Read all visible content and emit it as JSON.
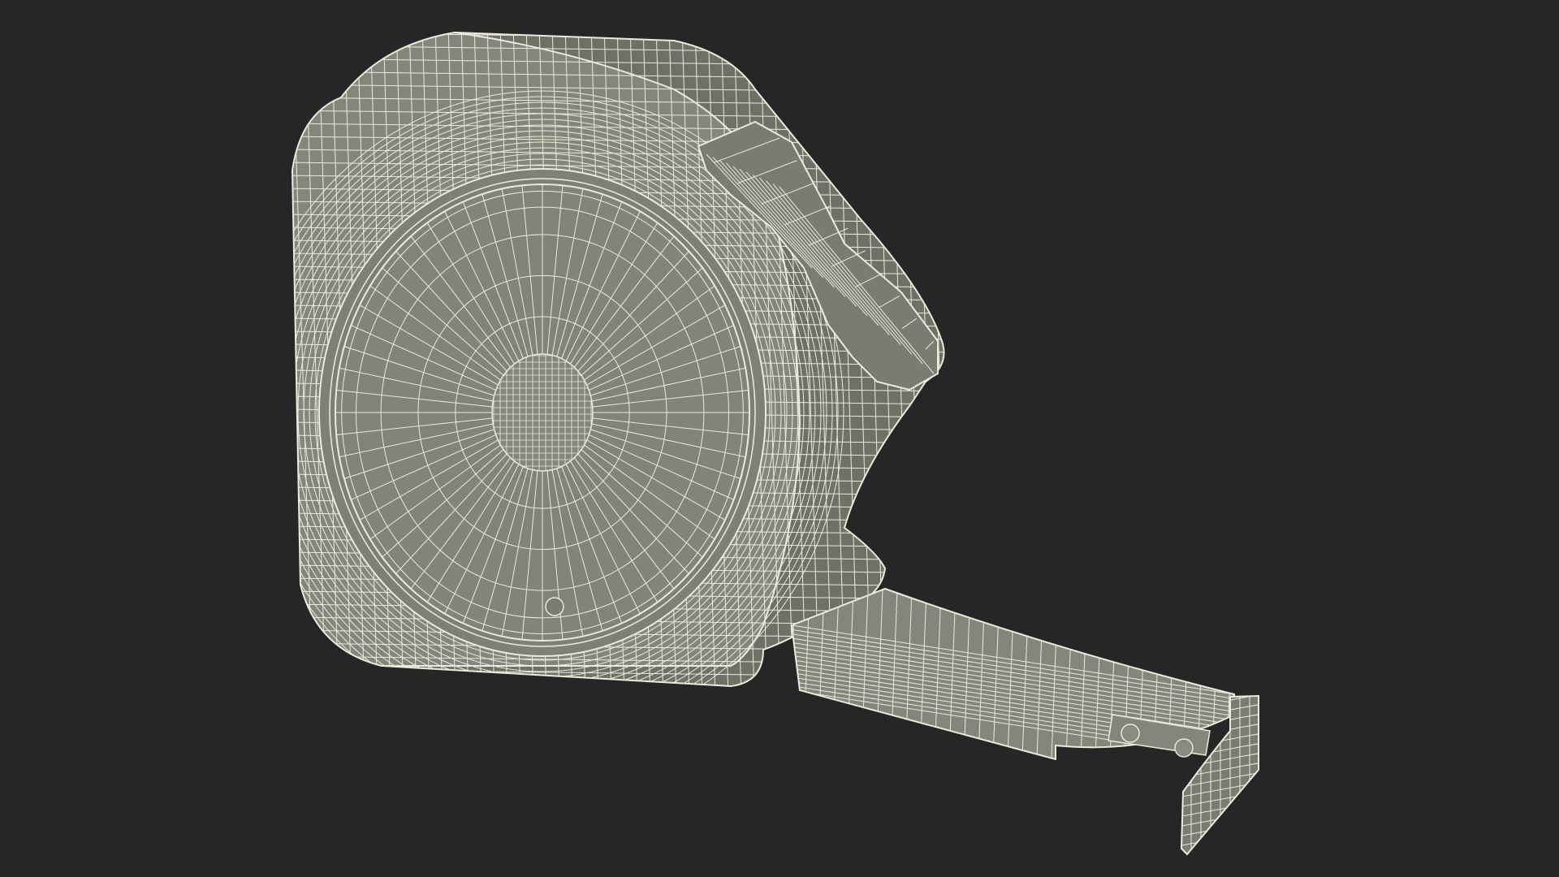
{
  "scene": {
    "subject": "tape-measure",
    "render_style": "wireframe",
    "colors": {
      "background": "#262626",
      "surface": "#85867a",
      "surface_shadow": "#6f7066",
      "wire": "#eceadc"
    }
  }
}
